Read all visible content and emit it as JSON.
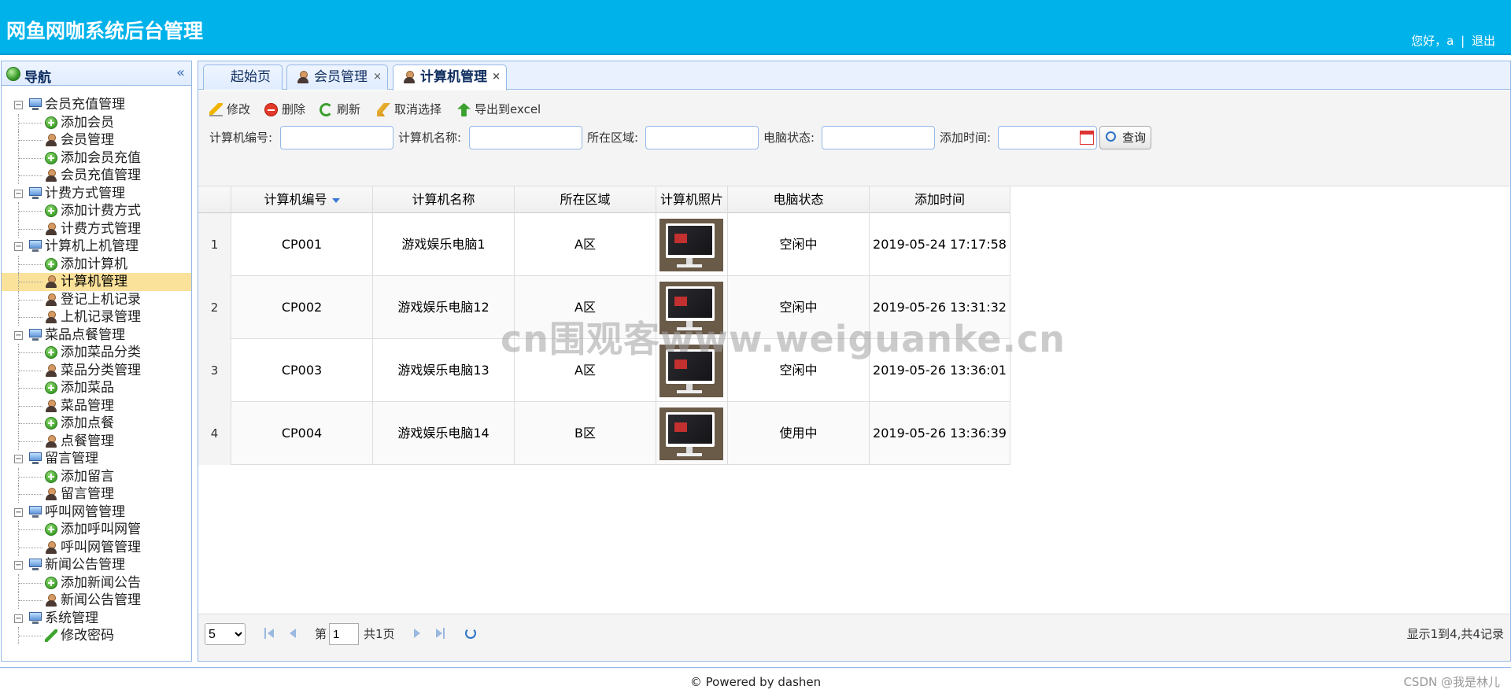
{
  "header": {
    "title": "网鱼网咖系统后台管理",
    "greeting": "您好，a",
    "separator": "|",
    "logout": "退出"
  },
  "nav": {
    "title": "导航",
    "groups": [
      {
        "label": "会员充值管理",
        "items": [
          "添加会员",
          "会员管理",
          "添加会员充值",
          "会员充值管理"
        ]
      },
      {
        "label": "计费方式管理",
        "items": [
          "添加计费方式",
          "计费方式管理"
        ]
      },
      {
        "label": "计算机上机管理",
        "items": [
          "添加计算机",
          "计算机管理",
          "登记上机记录",
          "上机记录管理"
        ]
      },
      {
        "label": "菜品点餐管理",
        "items": [
          "添加菜品分类",
          "菜品分类管理",
          "添加菜品",
          "菜品管理",
          "添加点餐",
          "点餐管理"
        ]
      },
      {
        "label": "留言管理",
        "items": [
          "添加留言",
          "留言管理"
        ]
      },
      {
        "label": "呼叫网管管理",
        "items": [
          "添加呼叫网管",
          "呼叫网管管理"
        ]
      },
      {
        "label": "新闻公告管理",
        "items": [
          "添加新闻公告",
          "新闻公告管理"
        ]
      },
      {
        "label": "系统管理",
        "items": [
          "修改密码"
        ]
      }
    ],
    "selected": "计算机管理"
  },
  "tabs": [
    {
      "label": "起始页",
      "closable": false
    },
    {
      "label": "会员管理",
      "closable": true
    },
    {
      "label": "计算机管理",
      "closable": true,
      "active": true
    }
  ],
  "tab_close": "×",
  "toolbar": {
    "edit": "修改",
    "delete": "删除",
    "refresh": "刷新",
    "cancel_select": "取消选择",
    "export": "导出到excel"
  },
  "filters": {
    "computer_no": "计算机编号:",
    "computer_name": "计算机名称:",
    "area": "所在区域:",
    "status": "电脑状态:",
    "add_time": "添加时间:",
    "query": "查询"
  },
  "grid": {
    "columns": [
      "计算机编号",
      "计算机名称",
      "所在区域",
      "计算机照片",
      "电脑状态",
      "添加时间"
    ],
    "rows": [
      {
        "n": "1",
        "no": "CP001",
        "name": "游戏娱乐电脑1",
        "area": "A区",
        "status": "空闲中",
        "time": "2019-05-24 17:17:58"
      },
      {
        "n": "2",
        "no": "CP002",
        "name": "游戏娱乐电脑12",
        "area": "A区",
        "status": "空闲中",
        "time": "2019-05-26 13:31:32"
      },
      {
        "n": "3",
        "no": "CP003",
        "name": "游戏娱乐电脑13",
        "area": "A区",
        "status": "空闲中",
        "time": "2019-05-26 13:36:01"
      },
      {
        "n": "4",
        "no": "CP004",
        "name": "游戏娱乐电脑14",
        "area": "B区",
        "status": "使用中",
        "time": "2019-05-26 13:36:39"
      }
    ]
  },
  "pager": {
    "page_size": "5",
    "page_prefix": "第",
    "page_value": "1",
    "page_suffix": "共1页",
    "summary": "显示1到4,共4记录"
  },
  "footer": "© Powered by dashen",
  "watermark": "cn围观客www.weiguanke.cn",
  "csdn": "CSDN @我是林儿"
}
